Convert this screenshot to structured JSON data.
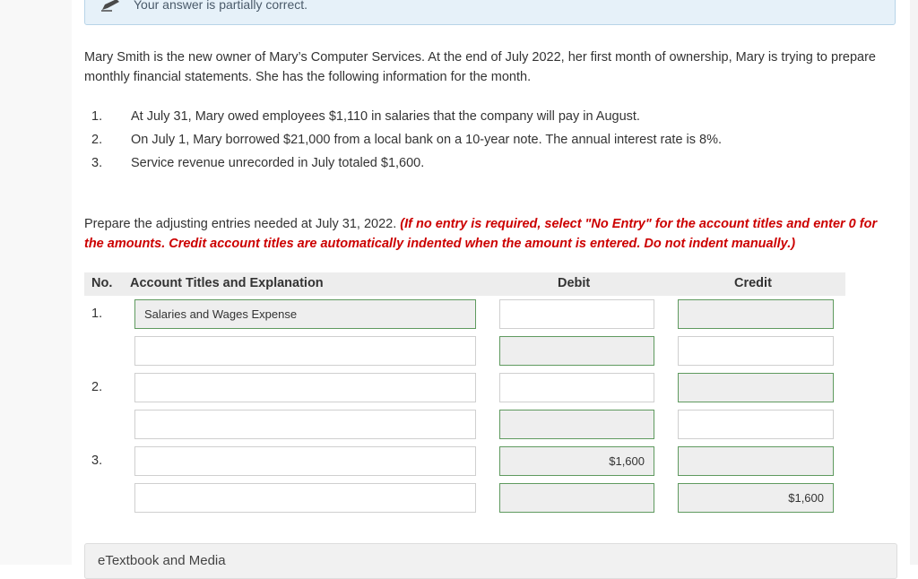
{
  "banner": {
    "text": "Your answer is partially correct.",
    "icon": "pencil-icon"
  },
  "intro": "Mary Smith is the new owner of Mary’s Computer Services. At the end of July 2022, her first month of ownership, Mary is trying to prepare monthly financial statements. She has the following information for the month.",
  "facts": [
    {
      "num": "1.",
      "text": "At July 31, Mary owed employees $1,110 in salaries that the company will pay in August."
    },
    {
      "num": "2.",
      "text": "On July 1, Mary borrowed $21,000 from a local bank on a 10-year note. The annual interest rate is 8%."
    },
    {
      "num": "3.",
      "text": "Service revenue unrecorded in July totaled $1,600."
    }
  ],
  "instructions": {
    "lead": "Prepare the adjusting entries needed at July 31, 2022. ",
    "note": "(If no entry is required, select \"No Entry\" for the account titles and enter 0 for the amounts. Credit account titles are automatically indented when the amount is entered. Do not indent manually.)"
  },
  "table": {
    "headers": {
      "no": "No.",
      "account": "Account Titles and Explanation",
      "debit": "Debit",
      "credit": "Credit"
    },
    "entries": [
      {
        "no": "1.",
        "lines": [
          {
            "account": "Salaries and Wages Expense",
            "debit": "",
            "credit": "",
            "acct_filled": true,
            "debit_filled": false,
            "credit_filled": true
          },
          {
            "account": "",
            "debit": "",
            "credit": "",
            "acct_filled": false,
            "debit_filled": true,
            "credit_filled": false
          }
        ]
      },
      {
        "no": "2.",
        "lines": [
          {
            "account": "",
            "debit": "",
            "credit": "",
            "acct_filled": false,
            "debit_filled": false,
            "credit_filled": true
          },
          {
            "account": "",
            "debit": "",
            "credit": "",
            "acct_filled": false,
            "debit_filled": true,
            "credit_filled": false
          }
        ]
      },
      {
        "no": "3.",
        "lines": [
          {
            "account": "",
            "debit": "$1,600",
            "credit": "",
            "acct_filled": false,
            "debit_filled": true,
            "credit_filled": true
          },
          {
            "account": "",
            "debit": "",
            "credit": "$1,600",
            "acct_filled": false,
            "debit_filled": true,
            "credit_filled": true
          }
        ]
      }
    ]
  },
  "etextbook": {
    "label": "eTextbook and Media"
  },
  "colors": {
    "banner_bg": "#e6f1f9",
    "instruction_red": "#cc0000",
    "filled_border": "#5f9a5f"
  }
}
